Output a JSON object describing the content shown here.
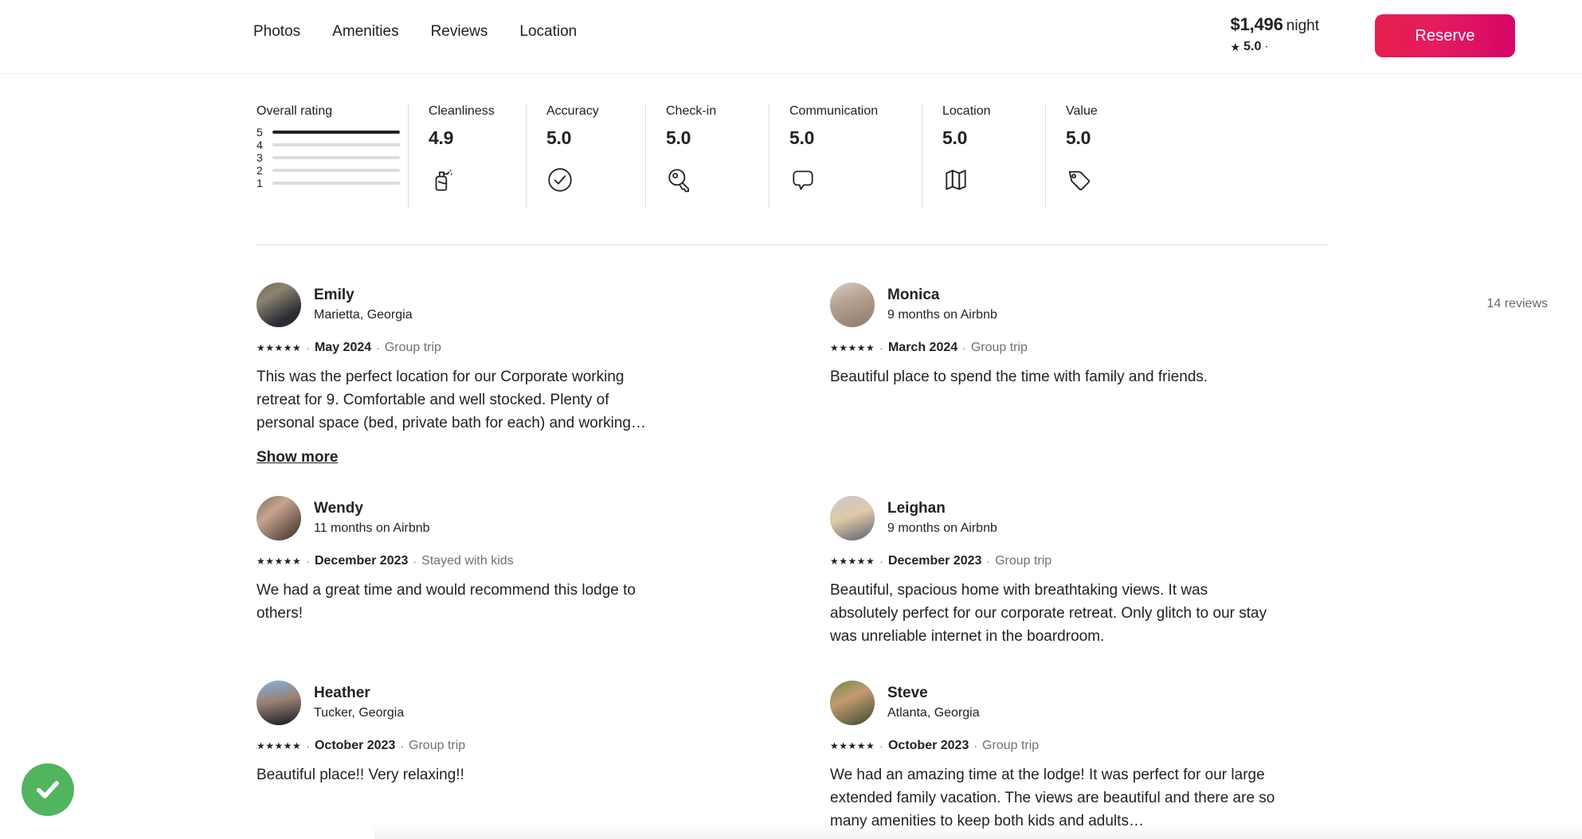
{
  "header": {
    "nav": [
      {
        "label": "Photos"
      },
      {
        "label": "Amenities"
      },
      {
        "label": "Reviews"
      },
      {
        "label": "Location"
      }
    ],
    "price": "$1,496",
    "price_unit": "night",
    "star_glyph": "★",
    "rating_value": "5.0",
    "separator": "·",
    "reviews_count": "14 reviews",
    "reserve_label": "Reserve",
    "accent_color": "#e31c5f"
  },
  "ratings": {
    "overall": {
      "title": "Overall rating",
      "rows": [
        {
          "label": "5",
          "percent": 100
        },
        {
          "label": "4",
          "percent": 0
        },
        {
          "label": "3",
          "percent": 0
        },
        {
          "label": "2",
          "percent": 0
        },
        {
          "label": "1",
          "percent": 0
        }
      ]
    },
    "categories": [
      {
        "title": "Cleanliness",
        "score": "4.9",
        "icon": "spray-bottle-icon"
      },
      {
        "title": "Accuracy",
        "score": "5.0",
        "icon": "check-circle-icon"
      },
      {
        "title": "Check-in",
        "score": "5.0",
        "icon": "key-icon"
      },
      {
        "title": "Communication",
        "score": "5.0",
        "icon": "speech-bubble-icon"
      },
      {
        "title": "Location",
        "score": "5.0",
        "icon": "map-icon"
      },
      {
        "title": "Value",
        "score": "5.0",
        "icon": "price-tag-icon"
      }
    ]
  },
  "reviews": [
    {
      "name": "Emily",
      "subtitle": "Marietta, Georgia",
      "stars": "★★★★★",
      "date": "May 2024",
      "trip_type": "Group trip",
      "text": "This was the perfect location for our Corporate working retreat for 9. Comfortable and well stocked. Plenty of personal space (bed, private bath for each) and working…",
      "show_more": "Show more"
    },
    {
      "name": "Monica",
      "subtitle": "9 months on Airbnb",
      "stars": "★★★★★",
      "date": "March 2024",
      "trip_type": "Group trip",
      "text": "Beautiful place to spend the time with family and friends.",
      "show_more": ""
    },
    {
      "name": "Wendy",
      "subtitle": "11 months on Airbnb",
      "stars": "★★★★★",
      "date": "December 2023",
      "trip_type": "Stayed with kids",
      "text": "We had a great time and would recommend this lodge to others!",
      "show_more": ""
    },
    {
      "name": "Leighan",
      "subtitle": "9 months on Airbnb",
      "stars": "★★★★★",
      "date": "December 2023",
      "trip_type": "Group trip",
      "text": "Beautiful, spacious home with breathtaking views. It was absolutely perfect for our corporate retreat. Only glitch to our stay was unreliable internet in the boardroom.",
      "show_more": ""
    },
    {
      "name": "Heather",
      "subtitle": "Tucker, Georgia",
      "stars": "★★★★★",
      "date": "October 2023",
      "trip_type": "Group trip",
      "text": "Beautiful place!! Very relaxing!!",
      "show_more": ""
    },
    {
      "name": "Steve",
      "subtitle": "Atlanta, Georgia",
      "stars": "★★★★★",
      "date": "October 2023",
      "trip_type": "Group trip",
      "text": "We had an amazing time at the lodge! It was perfect for our large extended family vacation. The views are beautiful and there are so many amenities to keep both kids and adults…",
      "show_more": ""
    }
  ],
  "badge": {
    "icon": "success-check-icon",
    "color": "#52b45f"
  }
}
